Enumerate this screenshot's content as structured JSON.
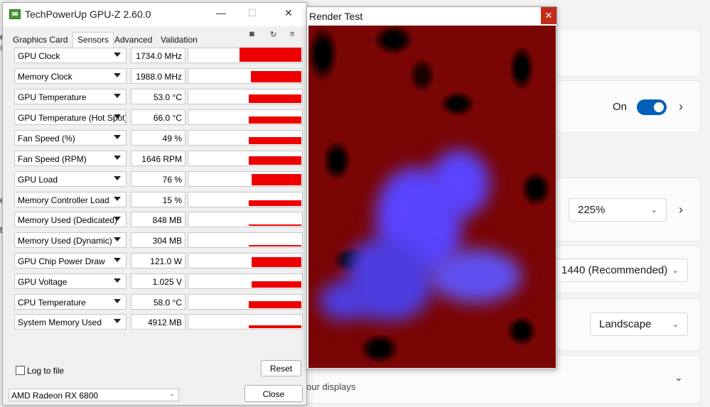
{
  "background_settings": {
    "edge_chars": [
      "e",
      "@",
      "e",
      "t"
    ],
    "toggle_label": "On",
    "scale_value": "225%",
    "resolution_value": "1440 (Recommended)",
    "orientation_value": "Landscape",
    "multi_display_text": "our displays"
  },
  "gpuz": {
    "title": "TechPowerUp GPU-Z 2.60.0",
    "tabs": [
      "Graphics Card",
      "Sensors",
      "Advanced",
      "Validation"
    ],
    "active_tab": "Sensors",
    "sensors": [
      {
        "name": "GPU Clock",
        "value": "1734.0 MHz"
      },
      {
        "name": "Memory Clock",
        "value": "1988.0 MHz"
      },
      {
        "name": "GPU Temperature",
        "value": "53.0 °C"
      },
      {
        "name": "GPU Temperature (Hot Spot)",
        "value": "66.0 °C"
      },
      {
        "name": "Fan Speed (%)",
        "value": "49 %"
      },
      {
        "name": "Fan Speed (RPM)",
        "value": "1646 RPM"
      },
      {
        "name": "GPU Load",
        "value": "76 %"
      },
      {
        "name": "Memory Controller Load",
        "value": "15 %"
      },
      {
        "name": "Memory Used (Dedicated)",
        "value": "848 MB"
      },
      {
        "name": "Memory Used (Dynamic)",
        "value": "304 MB"
      },
      {
        "name": "GPU Chip Power Draw",
        "value": "121.0 W"
      },
      {
        "name": "GPU Voltage",
        "value": "1.025 V"
      },
      {
        "name": "CPU Temperature",
        "value": "58.0 °C"
      },
      {
        "name": "System Memory Used",
        "value": "4912 MB"
      }
    ],
    "log_label": "Log to file",
    "reset_label": "Reset",
    "close_label": "Close",
    "gpu_selected": "AMD Radeon RX 6800"
  },
  "render_test": {
    "title": "Render Test",
    "close_glyph": "✕"
  },
  "colors": {
    "graph_red": "#ee0000",
    "toggle_blue": "#005fb8",
    "render_red": "#7a0505",
    "blob_blue": "#5a44ff"
  }
}
